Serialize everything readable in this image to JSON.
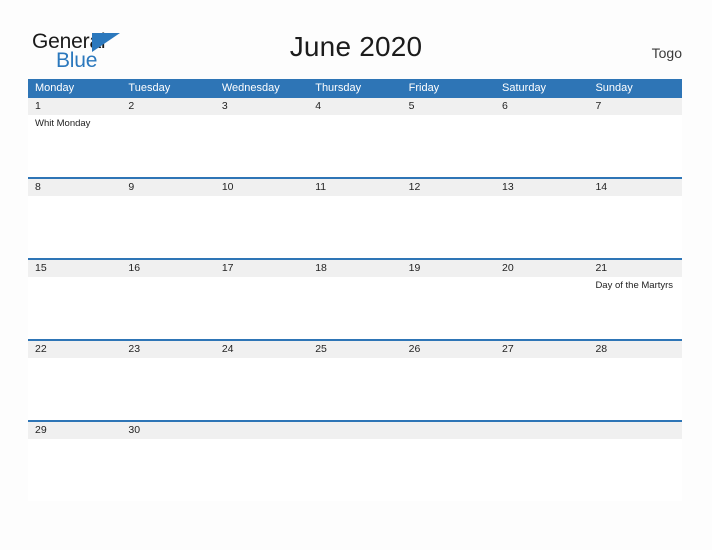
{
  "brand": {
    "name_part1": "General",
    "name_part2": "Blue",
    "accent_color": "#2b78bd"
  },
  "header": {
    "title": "June 2020",
    "country": "Togo"
  },
  "theme": {
    "header_blue": "#2e75b6",
    "row_gray": "#f0f0f0",
    "page_background": "#fdfdfd",
    "text_color": "#232323"
  },
  "calendar": {
    "month": "June",
    "year": "2020",
    "weekday_headers": [
      "Monday",
      "Tuesday",
      "Wednesday",
      "Thursday",
      "Friday",
      "Saturday",
      "Sunday"
    ],
    "weeks": [
      {
        "days": [
          {
            "date": "1",
            "event": "Whit Monday"
          },
          {
            "date": "2",
            "event": ""
          },
          {
            "date": "3",
            "event": ""
          },
          {
            "date": "4",
            "event": ""
          },
          {
            "date": "5",
            "event": ""
          },
          {
            "date": "6",
            "event": ""
          },
          {
            "date": "7",
            "event": ""
          }
        ]
      },
      {
        "days": [
          {
            "date": "8",
            "event": ""
          },
          {
            "date": "9",
            "event": ""
          },
          {
            "date": "10",
            "event": ""
          },
          {
            "date": "11",
            "event": ""
          },
          {
            "date": "12",
            "event": ""
          },
          {
            "date": "13",
            "event": ""
          },
          {
            "date": "14",
            "event": ""
          }
        ]
      },
      {
        "days": [
          {
            "date": "15",
            "event": ""
          },
          {
            "date": "16",
            "event": ""
          },
          {
            "date": "17",
            "event": ""
          },
          {
            "date": "18",
            "event": ""
          },
          {
            "date": "19",
            "event": ""
          },
          {
            "date": "20",
            "event": ""
          },
          {
            "date": "21",
            "event": "Day of the Martyrs"
          }
        ]
      },
      {
        "days": [
          {
            "date": "22",
            "event": ""
          },
          {
            "date": "23",
            "event": ""
          },
          {
            "date": "24",
            "event": ""
          },
          {
            "date": "25",
            "event": ""
          },
          {
            "date": "26",
            "event": ""
          },
          {
            "date": "27",
            "event": ""
          },
          {
            "date": "28",
            "event": ""
          }
        ]
      },
      {
        "days": [
          {
            "date": "29",
            "event": ""
          },
          {
            "date": "30",
            "event": ""
          },
          {
            "date": "",
            "event": ""
          },
          {
            "date": "",
            "event": ""
          },
          {
            "date": "",
            "event": ""
          },
          {
            "date": "",
            "event": ""
          },
          {
            "date": "",
            "event": ""
          }
        ]
      }
    ]
  }
}
